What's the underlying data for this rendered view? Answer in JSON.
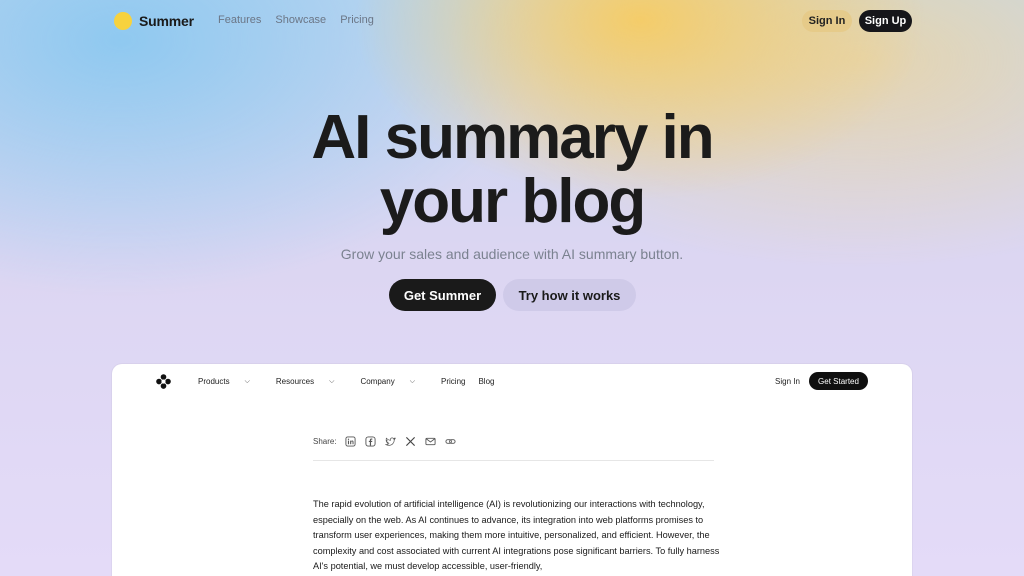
{
  "brand": {
    "name": "Summer",
    "sun_color": "#f7d23e"
  },
  "nav": {
    "links": [
      "Features",
      "Showcase",
      "Pricing"
    ],
    "sign_in": "Sign In",
    "sign_up": "Sign Up"
  },
  "hero": {
    "title_line1": "AI summary in",
    "title_line2": "your blog",
    "subtitle": "Grow your sales and audience with AI summary button.",
    "primary_cta": "Get Summer",
    "secondary_cta": "Try how it works"
  },
  "preview": {
    "nav": {
      "items": [
        "Products",
        "Resources",
        "Company",
        "Pricing",
        "Blog"
      ],
      "sign_in": "Sign In",
      "get_started": "Get Started"
    },
    "share": {
      "label": "Share:",
      "icons": [
        "linkedin-icon",
        "facebook-icon",
        "twitter-icon",
        "x-icon",
        "mail-icon",
        "link-icon"
      ]
    },
    "article_text": "The rapid evolution of artificial intelligence (AI) is revolutionizing our interactions with technology, especially on the web. As AI continues to advance, its integration into web platforms promises to transform user experiences, making them more intuitive, personalized, and efficient. However, the complexity and cost associated with current AI integrations pose significant barriers. To fully harness AI's potential, we must develop accessible, user-friendly,"
  }
}
